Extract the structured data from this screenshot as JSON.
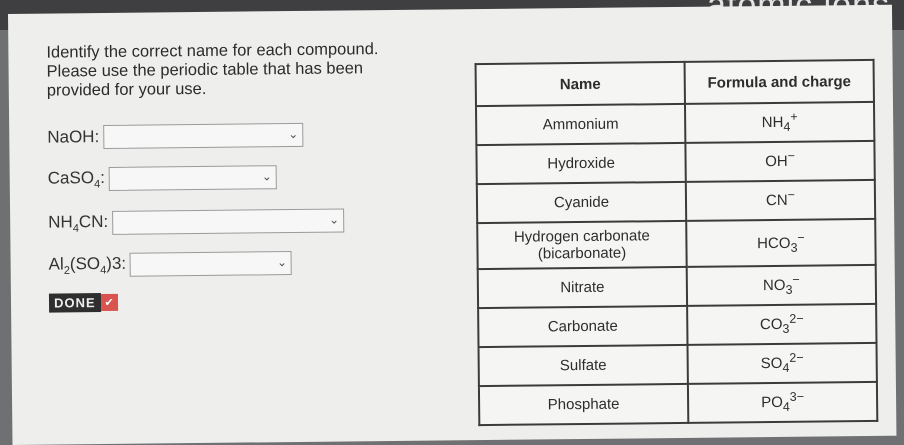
{
  "banner": "atomic ions",
  "prompt": "Identify the correct name for each compound. Please use the periodic table that has been provided for your use.",
  "questions": [
    {
      "pre": "NaOH:",
      "sub1": "",
      "mid": "",
      "sub2": "",
      "tail": "",
      "value": ""
    },
    {
      "pre": "CaSO",
      "sub1": "4",
      "mid": ":",
      "sub2": "",
      "tail": "",
      "value": ""
    },
    {
      "pre": "NH",
      "sub1": "4",
      "mid": "CN:",
      "sub2": "",
      "tail": "",
      "value": ""
    },
    {
      "pre": "Al",
      "sub1": "2",
      "mid": "(SO",
      "sub2": "4",
      "tail": ")3:",
      "value": ""
    }
  ],
  "done_label": "DONE",
  "table": {
    "headers": [
      "Name",
      "Formula and charge"
    ],
    "rows": [
      {
        "name": "Ammonium",
        "formula": "NH",
        "sub": "4",
        "sup": "+"
      },
      {
        "name": "Hydroxide",
        "formula": "OH",
        "sub": "",
        "sup": "−"
      },
      {
        "name": "Cyanide",
        "formula": "CN",
        "sub": "",
        "sup": "−"
      },
      {
        "name": "Hydrogen carbonate (bicarbonate)",
        "formula": "HCO",
        "sub": "3",
        "sup": "−"
      },
      {
        "name": "Nitrate",
        "formula": "NO",
        "sub": "3",
        "sup": "−"
      },
      {
        "name": "Carbonate",
        "formula": "CO",
        "sub": "3",
        "sup": "2−"
      },
      {
        "name": "Sulfate",
        "formula": "SO",
        "sub": "4",
        "sup": "2−"
      },
      {
        "name": "Phosphate",
        "formula": "PO",
        "sub": "4",
        "sup": "3−"
      }
    ]
  }
}
